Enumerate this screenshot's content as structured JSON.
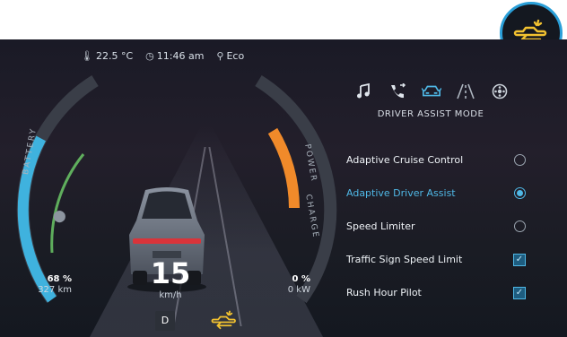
{
  "status": {
    "temperature": "22.5 °C",
    "time": "11:46 am",
    "drive_mode": "Eco"
  },
  "battery": {
    "label": "BATTERY",
    "percent": "68 %",
    "range": "327 km",
    "level": 0.68
  },
  "power": {
    "label_power": "POWER",
    "label_charge": "CHARGE",
    "percent": "0 %",
    "power_kw": "0 kW"
  },
  "speed": {
    "value": "15",
    "unit": "km/h"
  },
  "gear": "D",
  "mode": {
    "title": "DRIVER ASSIST MODE",
    "icons": [
      "music-icon",
      "phone-icon",
      "car-assist-icon",
      "road-icon",
      "settings-icon"
    ]
  },
  "options": [
    {
      "label": "Adaptive Cruise Control",
      "control": "radio",
      "selected": false
    },
    {
      "label": "Adaptive Driver Assist",
      "control": "radio",
      "selected": true
    },
    {
      "label": "Speed Limiter",
      "control": "radio",
      "selected": false
    },
    {
      "label": "Traffic Sign Speed Limit",
      "control": "checkbox",
      "checked": true
    },
    {
      "label": "Rush Hour Pilot",
      "control": "checkbox",
      "checked": true
    }
  ],
  "colors": {
    "accent": "#4fb8e6",
    "battery": "#3fb2de",
    "power": "#f08a2a",
    "callout_ring": "#2a9fd8",
    "icon_yellow": "#f2c230"
  }
}
